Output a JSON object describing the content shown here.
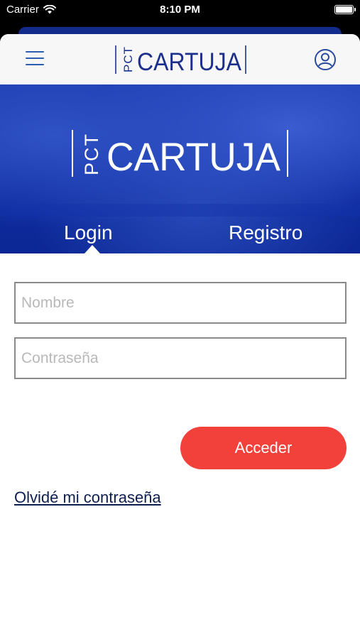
{
  "status_bar": {
    "carrier": "Carrier",
    "time": "8:10 PM"
  },
  "nav": {
    "logo_prefix": "PCT",
    "logo_text": "CARTUJA"
  },
  "hero": {
    "logo_prefix": "PCT",
    "logo_text": "CARTUJA",
    "tabs": [
      {
        "label": "Login",
        "active": true
      },
      {
        "label": "Registro",
        "active": false
      }
    ]
  },
  "form": {
    "nombre_placeholder": "Nombre",
    "password_placeholder": "Contraseña",
    "submit_label": "Acceder",
    "forgot_label": "Olvidé mi contraseña"
  },
  "colors": {
    "brand_blue": "#1a3bb0",
    "accent_red": "#f2413b",
    "logo_navy": "#1d2f8c",
    "icon_blue": "#2a5fb0"
  }
}
